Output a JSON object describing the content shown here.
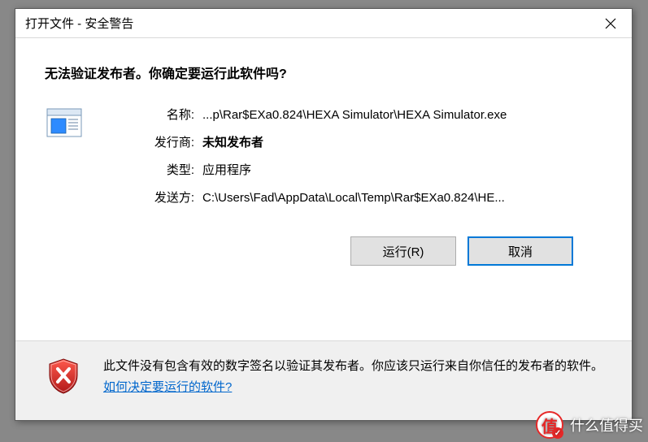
{
  "titlebar": {
    "text": "打开文件 - 安全警告"
  },
  "heading": "无法验证发布者。你确定要运行此软件吗?",
  "info": {
    "name_label": "名称:",
    "name_value": "...p\\Rar$EXa0.824\\HEXA Simulator\\HEXA Simulator.exe",
    "publisher_label": "发行商:",
    "publisher_value": "未知发布者",
    "type_label": "类型:",
    "type_value": "应用程序",
    "from_label": "发送方:",
    "from_value": "C:\\Users\\Fad\\AppData\\Local\\Temp\\Rar$EXa0.824\\HE..."
  },
  "buttons": {
    "run": "运行(R)",
    "cancel": "取消"
  },
  "bottom": {
    "text": "此文件没有包含有效的数字签名以验证其发布者。你应该只运行来自你信任的发布者的软件。",
    "link": "如何决定要运行的软件?"
  },
  "watermark": {
    "badge": "值",
    "text": "什么值得买"
  }
}
